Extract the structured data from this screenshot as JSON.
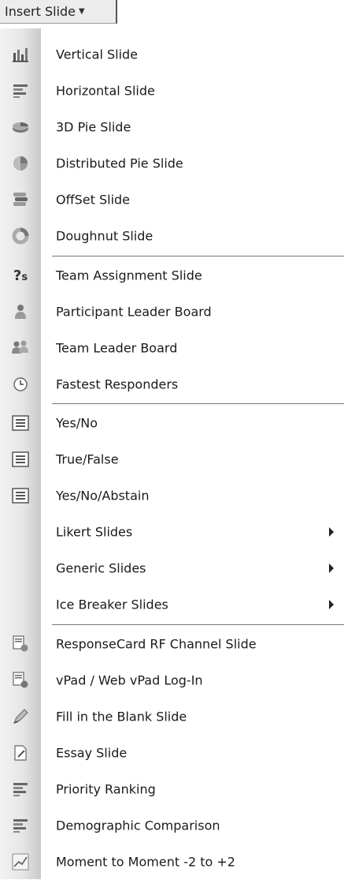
{
  "button": {
    "label": "Insert Slide",
    "arrow_icon": "dropdown-arrow-icon"
  },
  "menu": {
    "items": [
      {
        "label": "Vertical Slide",
        "icon": "vertical-bar-chart-icon",
        "submenu": false
      },
      {
        "label": "Horizontal Slide",
        "icon": "horizontal-bar-chart-icon",
        "submenu": false
      },
      {
        "label": "3D Pie Slide",
        "icon": "3d-pie-chart-icon",
        "submenu": false
      },
      {
        "label": "Distributed Pie Slide",
        "icon": "distributed-pie-chart-icon",
        "submenu": false
      },
      {
        "label": "OffSet Slide",
        "icon": "offset-chart-icon",
        "submenu": false
      },
      {
        "label": "Doughnut Slide",
        "icon": "doughnut-chart-icon",
        "submenu": false
      },
      {
        "label": "Team Assignment Slide",
        "icon": "team-assignment-icon",
        "submenu": false
      },
      {
        "label": "Participant Leader Board",
        "icon": "participant-leader-icon",
        "submenu": false
      },
      {
        "label": "Team Leader Board",
        "icon": "team-leader-icon",
        "submenu": false
      },
      {
        "label": "Fastest Responders",
        "icon": "clock-icon",
        "submenu": false
      },
      {
        "label": "Yes/No",
        "icon": "list-slide-icon",
        "submenu": false
      },
      {
        "label": "True/False",
        "icon": "list-slide-icon",
        "submenu": false
      },
      {
        "label": "Yes/No/Abstain",
        "icon": "list-slide-icon",
        "submenu": false
      },
      {
        "label": "Likert Slides",
        "icon": "",
        "submenu": true
      },
      {
        "label": "Generic Slides",
        "icon": "",
        "submenu": true
      },
      {
        "label": "Ice Breaker Slides",
        "icon": "",
        "submenu": true
      },
      {
        "label": "ResponseCard RF Channel Slide",
        "icon": "responsecard-channel-icon",
        "submenu": false
      },
      {
        "label": "vPad / Web vPad Log-In",
        "icon": "vpad-login-icon",
        "submenu": false
      },
      {
        "label": "Fill in the Blank Slide",
        "icon": "fill-in-blank-icon",
        "submenu": false
      },
      {
        "label": "Essay Slide",
        "icon": "essay-document-icon",
        "submenu": false
      },
      {
        "label": "Priority Ranking",
        "icon": "priority-ranking-icon",
        "submenu": false
      },
      {
        "label": "Demographic Comparison",
        "icon": "demographic-comparison-icon",
        "submenu": false
      },
      {
        "label": "Moment to Moment -2 to +2",
        "icon": "moment-to-moment-icon",
        "submenu": false
      }
    ]
  }
}
